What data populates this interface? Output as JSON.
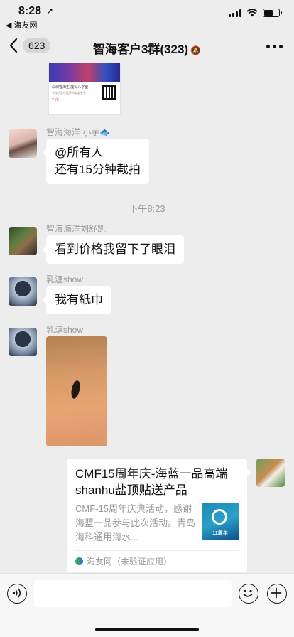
{
  "status_bar": {
    "time": "8:28",
    "back_app": "◀ 海友网",
    "battery_level": 0.6
  },
  "nav": {
    "unread_count": "623",
    "title": "智海客户3群(323)"
  },
  "chat": {
    "messages": [
      {
        "sender": "智海海洋  小芋🐟",
        "lines": [
          "@所有人",
          "还有15分钟截拍"
        ]
      },
      {
        "time_divider": "下午8:23"
      },
      {
        "sender": "智海海洋刘舒凯",
        "text": "看到价格我留下了眼泪"
      },
      {
        "sender": "乳溏show",
        "text": "我有紙巾"
      },
      {
        "sender": "乳溏show",
        "type": "image"
      },
      {
        "type": "link_card",
        "title": "CMF15周年庆-海蓝一品高端shanhu盐顶贴送产品",
        "description": "CMF-15周年庆典活动，感谢海蓝一品参与此次活动。青岛海科通用海水...",
        "thumb_label": "11周年",
        "source": "海友网（未验证应用）"
      }
    ],
    "partial_card": {
      "caption": "深圳智海生 座码八字型",
      "subcaption": "长按识别小程序码查看更多",
      "price": "¥ 78"
    }
  },
  "icons": {
    "back": "chevron-left-icon",
    "mute": "bell-slash-icon",
    "more": "ellipsis-icon",
    "voice": "voice-icon",
    "emoji": "smiley-icon",
    "plus": "plus-icon"
  }
}
